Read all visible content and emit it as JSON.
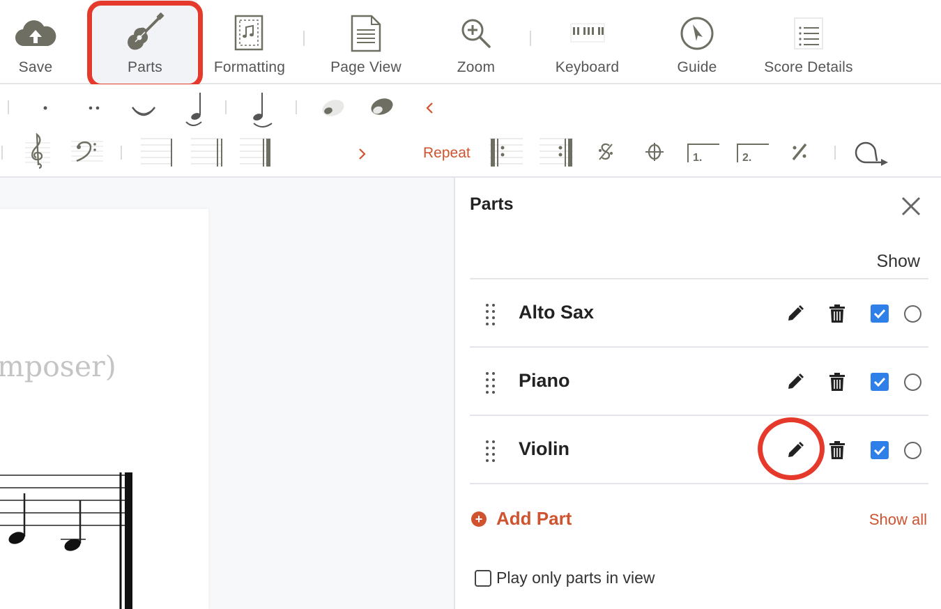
{
  "toolbar": {
    "items": [
      {
        "label": "Save",
        "icon": "cloud-upload-icon"
      },
      {
        "label": "Parts",
        "icon": "guitar-icon",
        "active": true
      },
      {
        "label": "Formatting",
        "icon": "formatting-page-icon"
      },
      {
        "label": "Page View",
        "icon": "page-view-icon"
      },
      {
        "label": "Zoom",
        "icon": "zoom-in-icon"
      },
      {
        "label": "Keyboard",
        "icon": "piano-keyboard-icon"
      },
      {
        "label": "Guide",
        "icon": "compass-icon"
      },
      {
        "label": "Score Details",
        "icon": "list-icon"
      }
    ]
  },
  "palette": {
    "repeat_label": "Repeat",
    "volta1": "1.",
    "volta2": "2."
  },
  "score": {
    "composer_fragment": "mposer)"
  },
  "parts_panel": {
    "title": "Parts",
    "show_header": "Show",
    "parts": [
      {
        "name": "Alto Sax",
        "visible": true
      },
      {
        "name": "Piano",
        "visible": true
      },
      {
        "name": "Violin",
        "visible": true
      }
    ],
    "add_part_label": "Add Part",
    "show_all_label": "Show all",
    "play_only_label": "Play only parts in view"
  },
  "colors": {
    "accent": "#d0532f",
    "highlight": "#e53a2b",
    "checkbox": "#2f7fe8",
    "icon_gray": "#6e6e62"
  }
}
